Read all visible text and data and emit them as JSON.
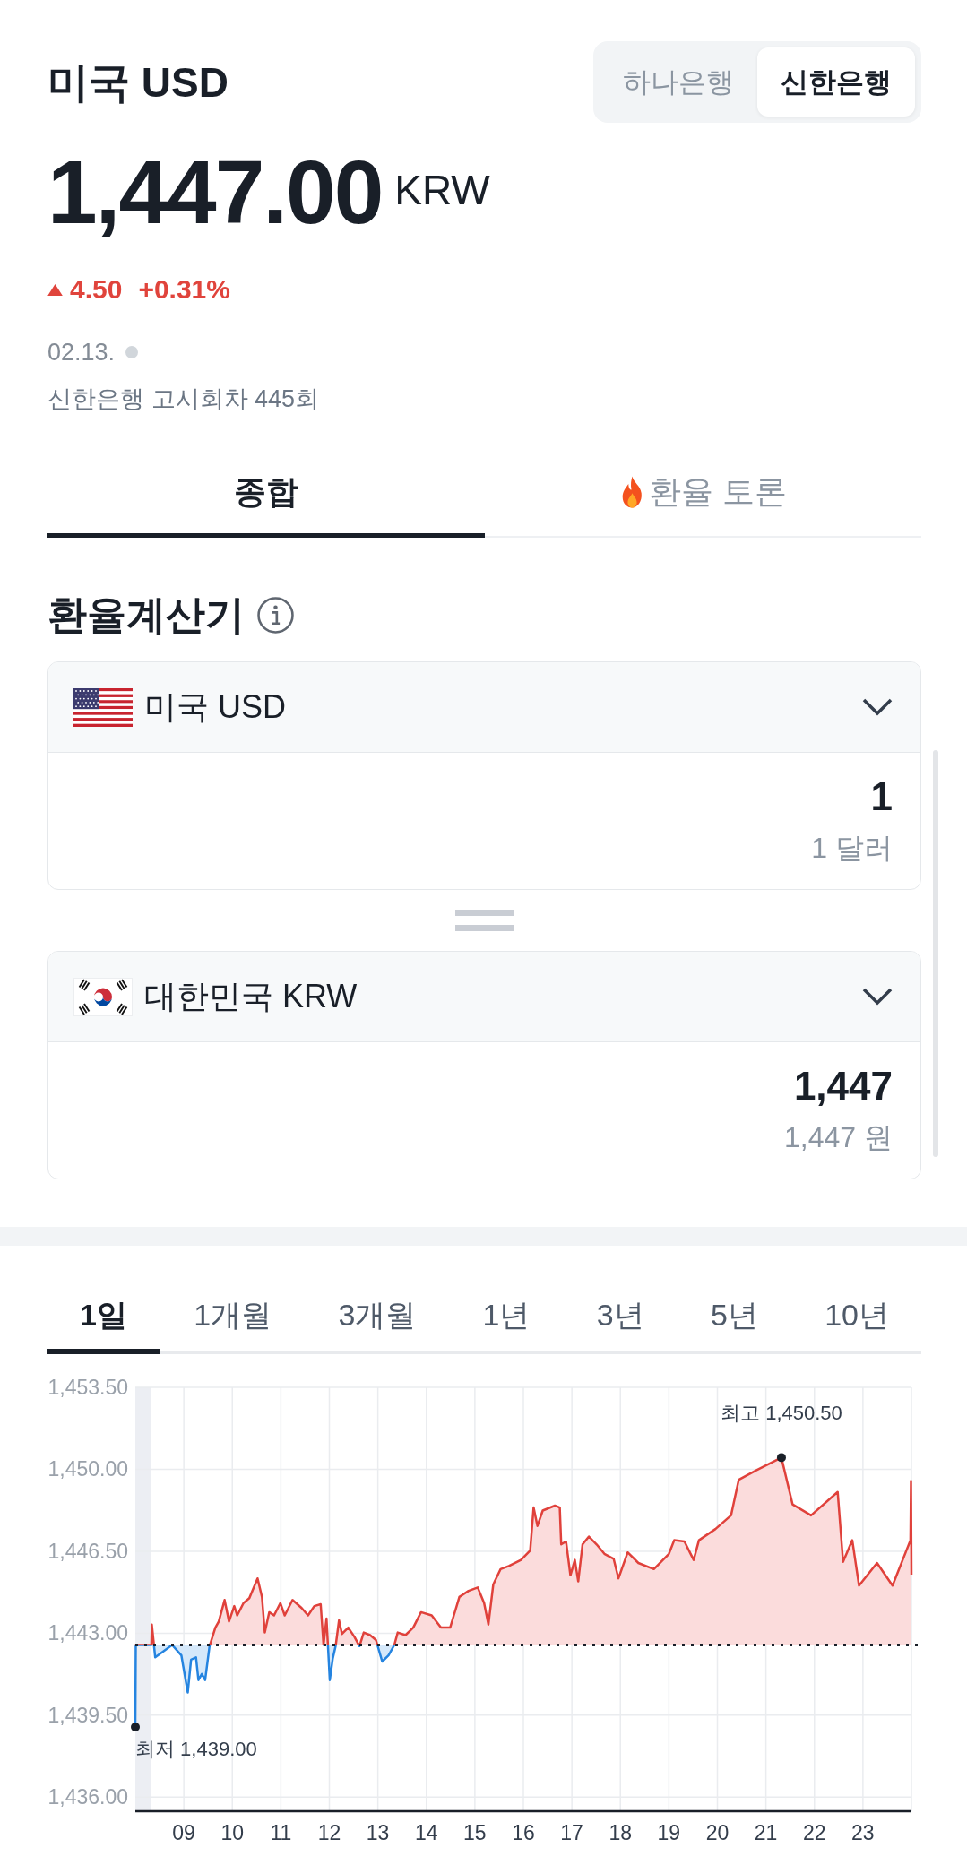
{
  "header": {
    "title": "미국 USD",
    "banks": [
      {
        "label": "하나은행",
        "selected": false
      },
      {
        "label": "신한은행",
        "selected": true
      }
    ]
  },
  "quote": {
    "price": "1,447.00",
    "currency": "KRW",
    "rising": true,
    "change": "4.50",
    "change_percent": "+0.31%",
    "date": "02.13.",
    "live": false,
    "notice": "신한은행 고시회차 445회"
  },
  "tabs": [
    {
      "label": "종합",
      "selected": true,
      "kind": "plain"
    },
    {
      "label": "환율 토론",
      "selected": false,
      "kind": "hot"
    }
  ],
  "calculator": {
    "title": "환율계산기",
    "rows": [
      {
        "kind": "us",
        "currency": "미국 USD",
        "value": "1",
        "value_in_words": "1 달러"
      },
      {
        "kind": "kr",
        "currency": "대한민국 KRW",
        "value": "1,447",
        "value_in_words": "1,447 원"
      }
    ]
  },
  "chart": {
    "periods": [
      {
        "label": "1일",
        "selected": true
      },
      {
        "label": "1개월",
        "selected": false
      },
      {
        "label": "3개월",
        "selected": false
      },
      {
        "label": "1년",
        "selected": false
      },
      {
        "label": "3년",
        "selected": false
      },
      {
        "label": "5년",
        "selected": false
      },
      {
        "label": "10년",
        "selected": false
      }
    ],
    "chart_data": {
      "type": "area",
      "grid": true,
      "x": [
        8.0,
        8.01,
        8.33,
        8.34,
        8.41,
        8.76,
        8.95,
        9.08,
        9.15,
        9.25,
        9.3,
        9.37,
        9.44,
        9.53,
        9.65,
        9.72,
        9.84,
        9.93,
        10.04,
        10.1,
        10.23,
        10.35,
        10.52,
        10.61,
        10.67,
        10.76,
        10.86,
        10.99,
        11.08,
        11.24,
        11.43,
        11.56,
        11.69,
        11.82,
        11.88,
        11.94,
        12.01,
        12.07,
        12.13,
        12.2,
        12.26,
        12.39,
        12.52,
        12.62,
        12.71,
        12.84,
        12.96,
        13.09,
        13.22,
        13.34,
        13.41,
        13.57,
        13.73,
        13.89,
        14.11,
        14.3,
        14.49,
        14.68,
        14.87,
        15.06,
        15.19,
        15.28,
        15.38,
        15.53,
        15.7,
        15.95,
        16.14,
        16.21,
        16.29,
        16.4,
        16.65,
        16.75,
        16.78,
        16.88,
        16.97,
        17.06,
        17.13,
        17.22,
        17.35,
        17.51,
        17.67,
        17.86,
        17.96,
        18.15,
        18.37,
        18.69,
        19.0,
        19.11,
        19.32,
        19.51,
        19.62,
        19.96,
        20.28,
        20.44,
        20.79,
        21.32,
        21.55,
        21.93,
        22.48,
        22.59,
        22.78,
        22.92,
        23.29,
        23.61,
        23.98,
        23.99,
        24.0
      ],
      "values": [
        1439.0,
        1442.5,
        1442.5,
        1443.37,
        1441.97,
        1442.5,
        1442.05,
        1440.47,
        1441.87,
        1441.97,
        1441.0,
        1441.26,
        1441.0,
        1442.45,
        1443.24,
        1443.5,
        1444.42,
        1443.5,
        1444.16,
        1443.76,
        1444.29,
        1444.5,
        1445.34,
        1444.55,
        1443.03,
        1443.9,
        1443.76,
        1444.29,
        1443.76,
        1444.42,
        1444.08,
        1443.76,
        1444.16,
        1444.24,
        1442.5,
        1443.63,
        1441.0,
        1441.92,
        1442.45,
        1443.55,
        1442.97,
        1443.24,
        1442.84,
        1442.45,
        1443.03,
        1442.92,
        1442.71,
        1441.79,
        1442.05,
        1442.5,
        1443.03,
        1442.92,
        1443.24,
        1443.9,
        1443.76,
        1443.24,
        1443.24,
        1444.55,
        1444.81,
        1444.95,
        1444.29,
        1443.37,
        1445.08,
        1445.74,
        1445.87,
        1446.13,
        1446.53,
        1448.37,
        1447.58,
        1448.24,
        1448.45,
        1448.37,
        1446.79,
        1446.92,
        1445.47,
        1446.13,
        1445.21,
        1446.79,
        1447.13,
        1446.79,
        1446.39,
        1446.18,
        1445.34,
        1446.45,
        1446.0,
        1445.74,
        1446.39,
        1446.97,
        1446.92,
        1446.13,
        1446.97,
        1447.45,
        1448.03,
        1449.55,
        1449.95,
        1450.5,
        1448.5,
        1448.03,
        1449.03,
        1446.05,
        1446.97,
        1445.03,
        1446.0,
        1445.03,
        1446.97,
        1449.5,
        1445.5
      ],
      "xlim": [
        8,
        24
      ],
      "ylim": [
        1435.4,
        1453.5
      ],
      "xticks": [
        {
          "value": 9,
          "label": "09"
        },
        {
          "value": 10,
          "label": "10"
        },
        {
          "value": 11,
          "label": "11"
        },
        {
          "value": 12,
          "label": "12"
        },
        {
          "value": 13,
          "label": "13"
        },
        {
          "value": 14,
          "label": "14"
        },
        {
          "value": 15,
          "label": "15"
        },
        {
          "value": 16,
          "label": "16"
        },
        {
          "value": 17,
          "label": "17"
        },
        {
          "value": 18,
          "label": "18"
        },
        {
          "value": 19,
          "label": "19"
        },
        {
          "value": 20,
          "label": "20"
        },
        {
          "value": 21,
          "label": "21"
        },
        {
          "value": 22,
          "label": "22"
        },
        {
          "value": 23,
          "label": "23"
        }
      ],
      "yticks": [
        {
          "value": 1453.5,
          "label": "1,453.50"
        },
        {
          "value": 1450,
          "label": "1,450.00"
        },
        {
          "value": 1446.5,
          "label": "1,446.50"
        },
        {
          "value": 1443,
          "label": "1,443.00"
        },
        {
          "value": 1439.5,
          "label": "1,439.50"
        },
        {
          "value": 1436,
          "label": "1,436.00"
        }
      ],
      "ref_lines": [
        {
          "axis": "y",
          "value": 1442.5
        }
      ],
      "bands": [
        {
          "axis": "x",
          "from": 8,
          "to": 8.32
        }
      ],
      "annotations": [
        {
          "text": "최저 1,439.00",
          "x": 8,
          "y": 1439
        },
        {
          "text": "최고 1,450.50",
          "x": 21.32,
          "y": 1450.5
        }
      ]
    }
  }
}
